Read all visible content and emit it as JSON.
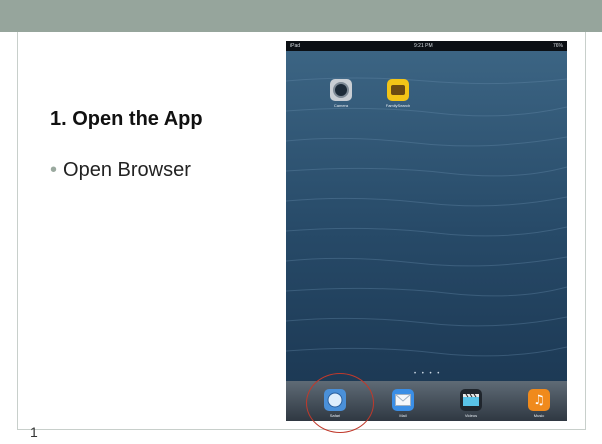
{
  "slide": {
    "heading": "1. Open the App",
    "bullet": "Open Browser",
    "page_number": "1"
  },
  "ipad": {
    "status_left": "iPad",
    "status_time": "9:21 PM",
    "status_battery": "76%",
    "home_apps": [
      {
        "label": "Camera",
        "icon": "camera-icon"
      },
      {
        "label": "FamilySearch",
        "icon": "familysearch-icon"
      }
    ],
    "dock_apps": [
      {
        "label": "Safari",
        "icon": "safari-icon"
      },
      {
        "label": "Mail",
        "icon": "mail-icon"
      },
      {
        "label": "Videos",
        "icon": "videos-icon"
      },
      {
        "label": "Music",
        "icon": "music-icon"
      }
    ]
  },
  "colors": {
    "header_bar": "#96a59c",
    "highlight_ring": "#c0392b"
  }
}
